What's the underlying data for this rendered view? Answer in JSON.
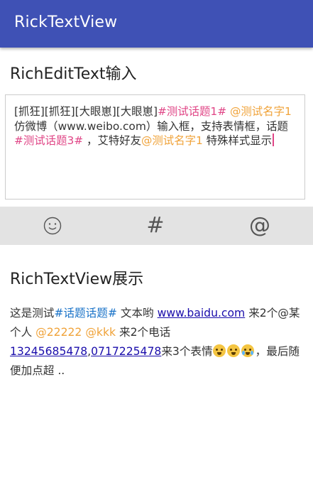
{
  "app": {
    "title": "RickTextView"
  },
  "edit_section": {
    "heading": "RichEditText输入"
  },
  "editor": {
    "segments": [
      {
        "text": "[抓狂][抓狂][大眼崽][大眼崽]",
        "type": "plain"
      },
      {
        "text": "#测试话题1#",
        "type": "topic"
      },
      {
        "text": " ",
        "type": "plain"
      },
      {
        "text": "@测试名字1",
        "type": "user"
      },
      {
        "text": " 仿微博（www.weibo.com）输入框，支持表情框，话题",
        "type": "plain"
      },
      {
        "text": "#测试话题3#",
        "type": "topic"
      },
      {
        "text": " ，艾特好友",
        "type": "plain"
      },
      {
        "text": "@测试名字1",
        "type": "user"
      },
      {
        "text": " 特殊样式显示",
        "type": "plain"
      }
    ]
  },
  "toolbar": {
    "emoji_button": "emoji-icon",
    "topic_button": "#",
    "mention_button": "@"
  },
  "display_section": {
    "heading": "RichTextView展示"
  },
  "display": {
    "segments": [
      {
        "text": "这是测试",
        "type": "plain"
      },
      {
        "text": "#话题话题#",
        "type": "blue"
      },
      {
        "text": " 文本哟 ",
        "type": "plain"
      },
      {
        "text": "www.baidu.com",
        "type": "link"
      },
      {
        "text": " 来2个@某个人 ",
        "type": "plain"
      },
      {
        "text": "@22222",
        "type": "user"
      },
      {
        "text": " ",
        "type": "plain"
      },
      {
        "text": "@kkk",
        "type": "user"
      },
      {
        "text": " 来2个电话 ",
        "type": "plain"
      },
      {
        "text": "13245685478",
        "type": "link"
      },
      {
        "text": ",",
        "type": "plain"
      },
      {
        "text": "0717225478",
        "type": "link"
      },
      {
        "text": "来3个表情",
        "type": "plain"
      },
      {
        "text": "",
        "type": "emojis"
      },
      {
        "text": "，最后随便加点超 ..",
        "type": "plain"
      }
    ]
  },
  "colors": {
    "appbar": "#3f51b5",
    "topic": "#e04586",
    "user": "#f0a33a",
    "link": "#1a0dab",
    "blue_topic": "#1a73c8"
  }
}
